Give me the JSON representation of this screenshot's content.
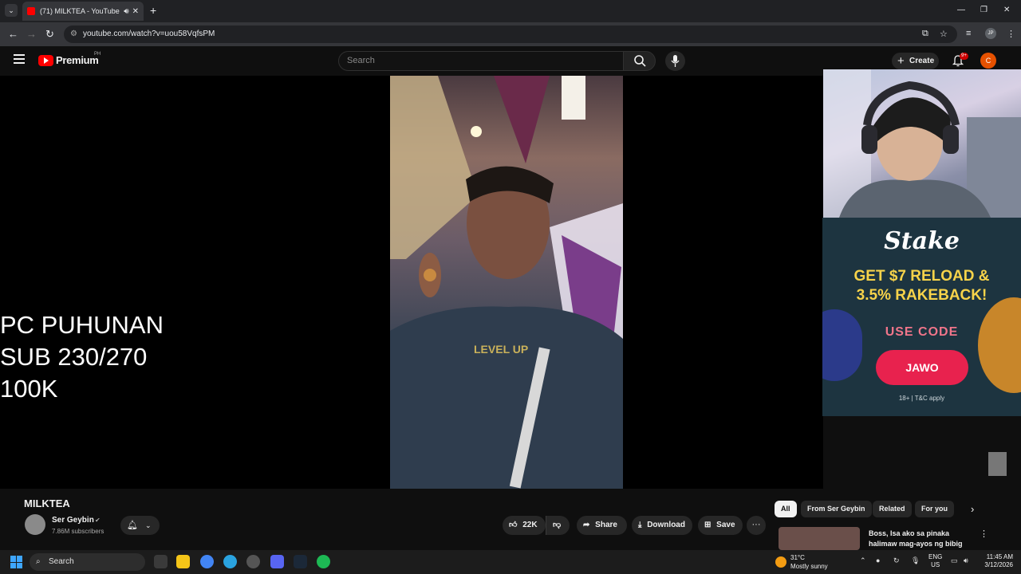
{
  "browser": {
    "tab_title": "(71) MILKTEA - YouTube",
    "url": "youtube.com/watch?v=uou58VqfsPM",
    "profile_initials": "JP"
  },
  "youtube_header": {
    "logo_text": "Premium",
    "country_code": "PH",
    "search_placeholder": "Search",
    "create_label": "Create",
    "notification_badge": "9+",
    "user_initial": "C"
  },
  "overlay_text": {
    "line1": "PC PUHUNAN",
    "line2": "SUB 230/270",
    "line3": "100K"
  },
  "video_frame": {
    "shirt_text": "LEVEL UP"
  },
  "ad": {
    "brand": "Stake",
    "headline_line1": "GET $7 RELOAD &",
    "headline_line2": "3.5% RAKEBACK!",
    "code_label": "USE CODE",
    "code": "JAWO",
    "fine_print": "18+ | T&C apply"
  },
  "video_info": {
    "title": "MILKTEA",
    "channel_name": "Ser Geybin",
    "subscribers": "7.86M subscribers",
    "like_count": "22K",
    "share_label": "Share",
    "download_label": "Download",
    "save_label": "Save"
  },
  "chips": [
    "All",
    "From Ser Geybin",
    "Related",
    "For you"
  ],
  "related": {
    "title_line1": "Boss, Isa ako sa pinaka",
    "title_line2": "halimaw mag-ayos ng bibig"
  },
  "taskbar": {
    "search_label": "Search",
    "weather_temp": "31°C",
    "weather_cond": "Mostly sunny",
    "lang_line1": "ENG",
    "lang_line2": "US",
    "time": "11:45 AM",
    "date": "3/12/2026"
  }
}
